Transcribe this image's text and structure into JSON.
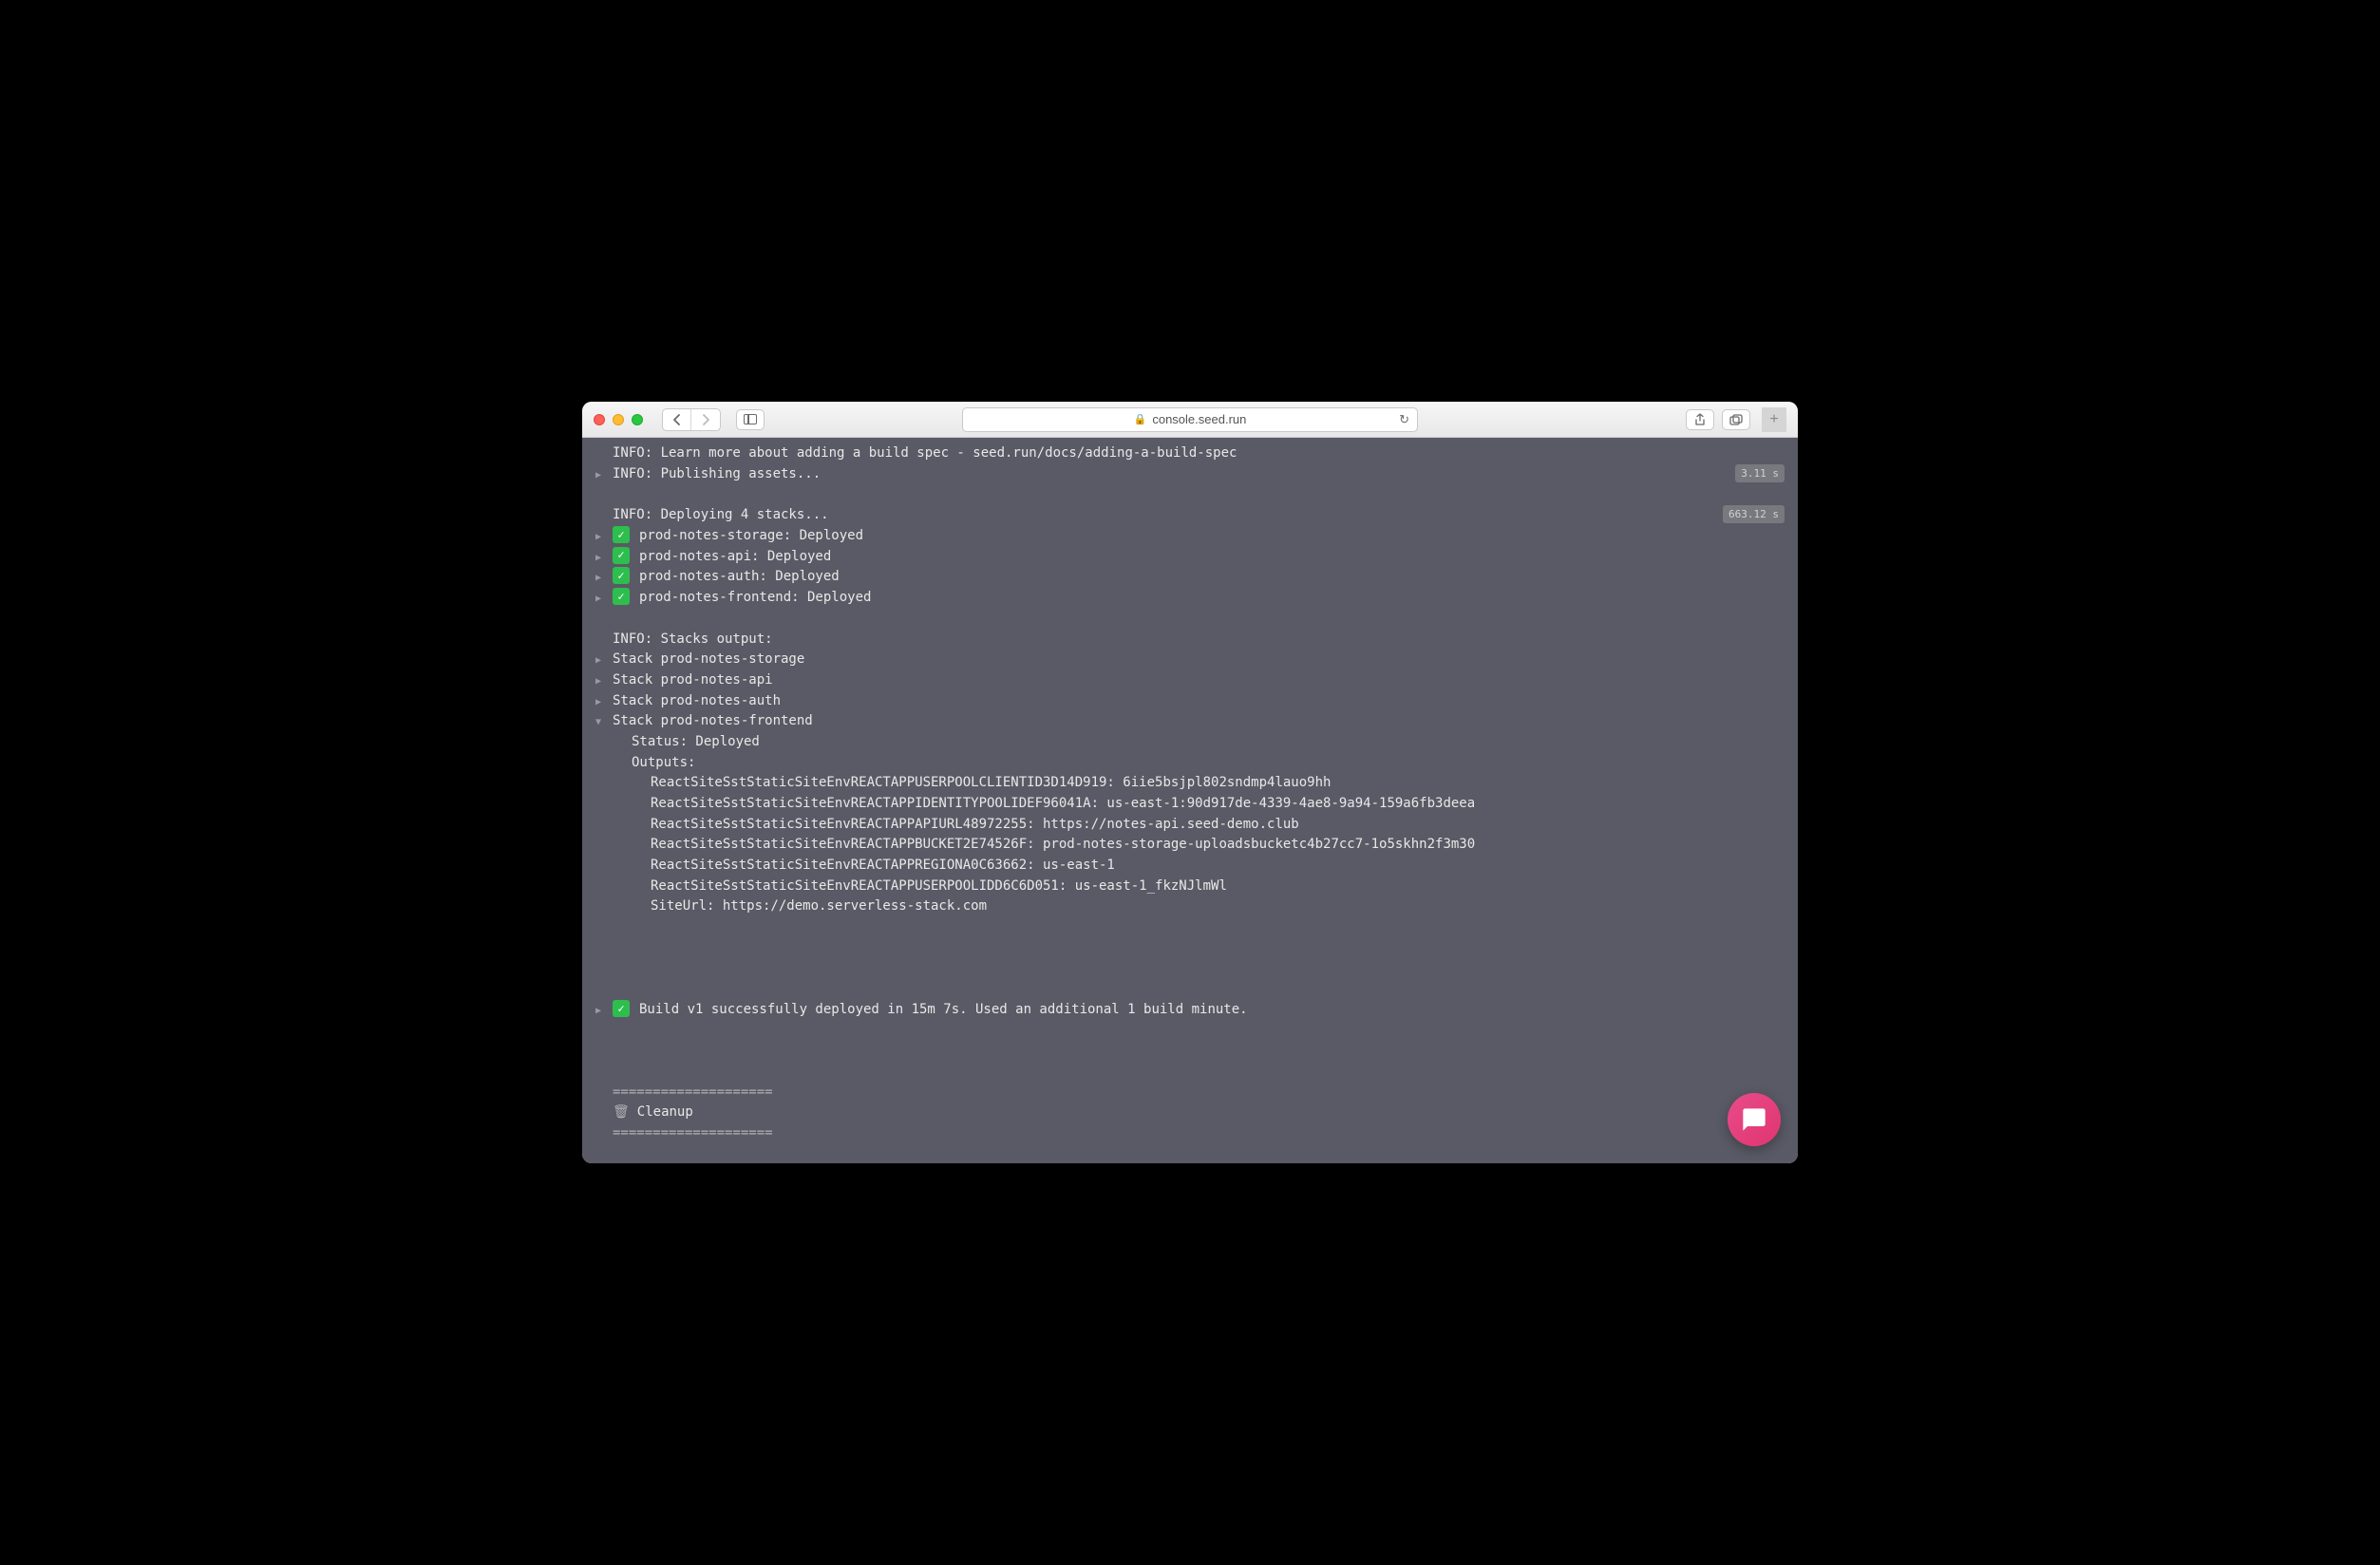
{
  "browser": {
    "url_host": "console.seed.run"
  },
  "log": {
    "build_spec_line": "INFO: Learn more about adding a build spec - seed.run/docs/adding-a-build-spec",
    "publish_line": "INFO: Publishing assets...",
    "publish_time": "3.11 s",
    "deploy_header": "INFO: Deploying 4 stacks...",
    "deploy_time": "663.12 s",
    "deployed_stacks": [
      "prod-notes-storage: Deployed",
      "prod-notes-api: Deployed",
      "prod-notes-auth: Deployed",
      "prod-notes-frontend: Deployed"
    ],
    "stacks_output_header": "INFO: Stacks output:",
    "collapsed_stacks": [
      "Stack prod-notes-storage",
      "Stack prod-notes-api",
      "Stack prod-notes-auth"
    ],
    "expanded_stack": "Stack prod-notes-frontend",
    "status_line": "Status: Deployed",
    "outputs_label": "Outputs:",
    "outputs": [
      "ReactSiteSstStaticSiteEnvREACTAPPUSERPOOLCLIENTID3D14D919: 6iie5bsjpl802sndmp4lauo9hh",
      "ReactSiteSstStaticSiteEnvREACTAPPIDENTITYPOOLIDEF96041A: us-east-1:90d917de-4339-4ae8-9a94-159a6fb3deea",
      "ReactSiteSstStaticSiteEnvREACTAPPAPIURL48972255: https://notes-api.seed-demo.club",
      "ReactSiteSstStaticSiteEnvREACTAPPBUCKET2E74526F: prod-notes-storage-uploadsbucketc4b27cc7-1o5skhn2f3m30",
      "ReactSiteSstStaticSiteEnvREACTAPPREGIONA0C63662: us-east-1",
      "ReactSiteSstStaticSiteEnvREACTAPPUSERPOOLIDD6C6D051: us-east-1_fkzNJlmWl",
      "SiteUrl: https://demo.serverless-stack.com"
    ],
    "success_line": "Build v1 successfully deployed in 15m 7s. Used an additional 1 build minute.",
    "divider": "====================",
    "cleanup_label": "Cleanup"
  }
}
